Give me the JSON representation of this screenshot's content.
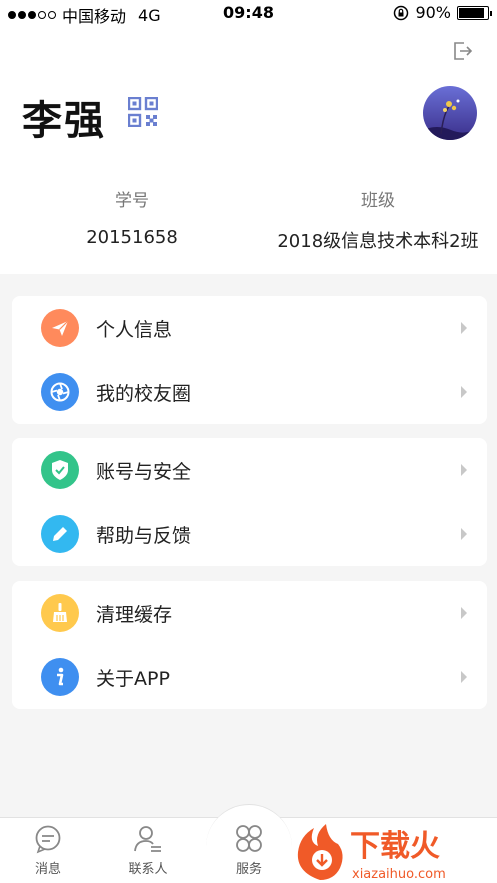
{
  "status_bar": {
    "carrier": "中国移动",
    "network": "4G",
    "time": "09:48",
    "battery": "90%",
    "battery_level": 0.9
  },
  "profile": {
    "name": "李强",
    "student_id_label": "学号",
    "student_id": "20151658",
    "class_label": "班级",
    "class_name": "2018级信息技术本科2班"
  },
  "menu_groups": [
    {
      "items": [
        {
          "label": "个人信息",
          "icon": "paper-plane-icon",
          "color": "#FF8A5C"
        },
        {
          "label": "我的校友圈",
          "icon": "aperture-icon",
          "color": "#3F8FF0"
        }
      ]
    },
    {
      "items": [
        {
          "label": "账号与安全",
          "icon": "shield-check-icon",
          "color": "#33C48A"
        },
        {
          "label": "帮助与反馈",
          "icon": "pencil-icon",
          "color": "#33B8F0"
        }
      ]
    },
    {
      "items": [
        {
          "label": "清理缓存",
          "icon": "broom-icon",
          "color": "#FFC94D"
        },
        {
          "label": "关于APP",
          "icon": "info-icon",
          "color": "#3F8FF0"
        }
      ]
    }
  ],
  "tabs": [
    {
      "label": "消息",
      "icon": "chat-icon"
    },
    {
      "label": "联系人",
      "icon": "contact-icon"
    },
    {
      "label": "服务",
      "icon": "grid-icon"
    }
  ],
  "watermark": {
    "text": "下载火",
    "site": "xiazaihuo.com"
  }
}
